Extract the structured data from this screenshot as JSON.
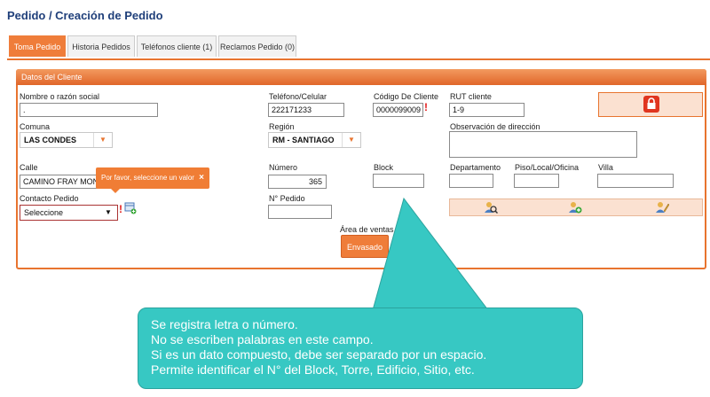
{
  "header": {
    "title": "Pedido / Creación de Pedido"
  },
  "tabs": [
    {
      "label": "Toma Pedido",
      "active": true
    },
    {
      "label": "Historia Pedidos",
      "active": false
    },
    {
      "label": "Teléfonos cliente (1)",
      "active": false
    },
    {
      "label": "Reclamos Pedido (0)",
      "active": false
    }
  ],
  "section": {
    "title": "Datos del Cliente"
  },
  "form": {
    "nombre": {
      "label": "Nombre o razón social",
      "value": "."
    },
    "telefono": {
      "label": "Teléfono/Celular",
      "value": "222171233"
    },
    "codigo": {
      "label": "Código De Cliente",
      "value": "0000099009"
    },
    "rut": {
      "label": "RUT cliente",
      "value": "1-9"
    },
    "comuna": {
      "label": "Comuna",
      "value": "LAS CONDES"
    },
    "region": {
      "label": "Región",
      "value": "RM - SANTIAGO"
    },
    "observacion": {
      "label": "Observación de dirección",
      "value": ""
    },
    "calle": {
      "label": "Calle",
      "value": "CAMINO FRAY MONTALVA"
    },
    "numero": {
      "label": "Número",
      "value": "365"
    },
    "block": {
      "label": "Block",
      "value": ""
    },
    "departamento": {
      "label": "Departamento",
      "value": ""
    },
    "piso": {
      "label": "Piso/Local/Oficina",
      "value": ""
    },
    "villa": {
      "label": "Villa",
      "value": ""
    },
    "contacto": {
      "label": "Contacto Pedido",
      "value": "Seleccione"
    },
    "npedido": {
      "label": "N° Pedido",
      "value": ""
    },
    "area": {
      "label": "Área de ventas",
      "button": "Envasado"
    }
  },
  "tooltip": {
    "text": "Por favor, seleccione un valor",
    "close": "×"
  },
  "callout": {
    "lines": [
      "Se registra letra o número.",
      "No se escriben palabras en este campo.",
      "Si es un dato compuesto, debe ser separado por un espacio.",
      "Permite identificar  el N°  del  Block, Torre, Edificio, Sitio, etc."
    ]
  },
  "colors": {
    "accent": "#ef7d3a",
    "callout": "#37c8c3",
    "title": "#1f3f7a"
  },
  "icons": [
    "lock-icon",
    "search-user-icon",
    "add-user-icon",
    "edit-user-icon",
    "add-contact-icon",
    "required-icon"
  ]
}
